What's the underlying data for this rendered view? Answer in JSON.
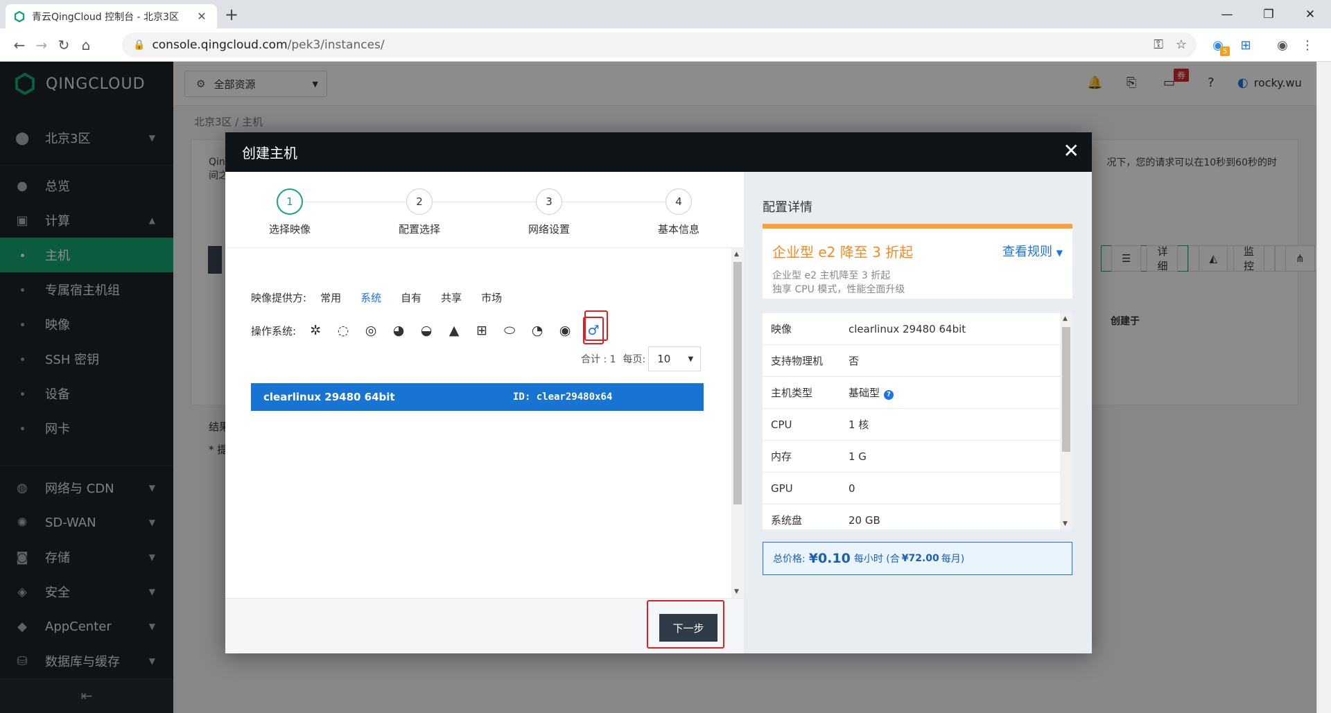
{
  "browser": {
    "tab_title": "青云QingCloud 控制台 - 北京3区",
    "url_host": "console.qingcloud.com",
    "url_path": "/pek3/instances/",
    "ext_badge": "5"
  },
  "sidebar": {
    "brand": "QINGCLOUD",
    "zone": "北京3区",
    "items": [
      {
        "label": "总览"
      },
      {
        "label": "计算"
      },
      {
        "label": "主机"
      },
      {
        "label": "专属宿主机组"
      },
      {
        "label": "映像"
      },
      {
        "label": "SSH 密钥"
      },
      {
        "label": "设备"
      },
      {
        "label": "网卡"
      },
      {
        "label": "网络与 CDN"
      },
      {
        "label": "SD-WAN"
      },
      {
        "label": "存储"
      },
      {
        "label": "安全"
      },
      {
        "label": "AppCenter"
      },
      {
        "label": "数据库与缓存"
      }
    ]
  },
  "topbar": {
    "resource_label": "全部资源",
    "coupon": "券",
    "username": "rocky.wu"
  },
  "background": {
    "breadcrumb": "北京3区 / 主机",
    "desc_left": "Qin\n间之",
    "desc_right": "况下，您的请求可以在10秒到60秒的时",
    "result": "结果",
    "hint": "* 提",
    "view_detail": "详细",
    "view_monitor": "监控",
    "view_catalog": "目录",
    "col_created": "创建于"
  },
  "modal": {
    "title": "创建主机",
    "steps": [
      {
        "num": "1",
        "label": "选择映像"
      },
      {
        "num": "2",
        "label": "配置选择"
      },
      {
        "num": "3",
        "label": "网络设置"
      },
      {
        "num": "4",
        "label": "基本信息"
      }
    ],
    "provider_label": "映像提供方:",
    "providers": [
      "常用",
      "系统",
      "自有",
      "共享",
      "市场"
    ],
    "os_label": "操作系统:",
    "total_label": "合计 : 1",
    "per_page_label": "每页:",
    "per_page_value": "10",
    "image_name": "clearlinux 29480 64bit",
    "image_id": "ID: clear29480x64",
    "next_button": "下一步"
  },
  "config": {
    "title": "配置详情",
    "promo_title": "企业型 e2 降至 3 折起",
    "promo_link": "查看规则",
    "promo_line1": "企业型 e2 主机降至 3 折起",
    "promo_line2": "独享 CPU 模式，性能全面升级",
    "rows": [
      {
        "k": "映像",
        "v": "clearlinux 29480 64bit"
      },
      {
        "k": "支持物理机",
        "v": "否"
      },
      {
        "k": "主机类型",
        "v": "基础型"
      },
      {
        "k": "CPU",
        "v": "1 核"
      },
      {
        "k": "内存",
        "v": "1 G"
      },
      {
        "k": "GPU",
        "v": "0"
      },
      {
        "k": "系统盘",
        "v": "20 GB"
      }
    ],
    "total_label": "总价格:",
    "price": "¥0.10",
    "per_hour": "每小时 (合",
    "monthly": "¥72.00",
    "per_month": "每月)"
  }
}
